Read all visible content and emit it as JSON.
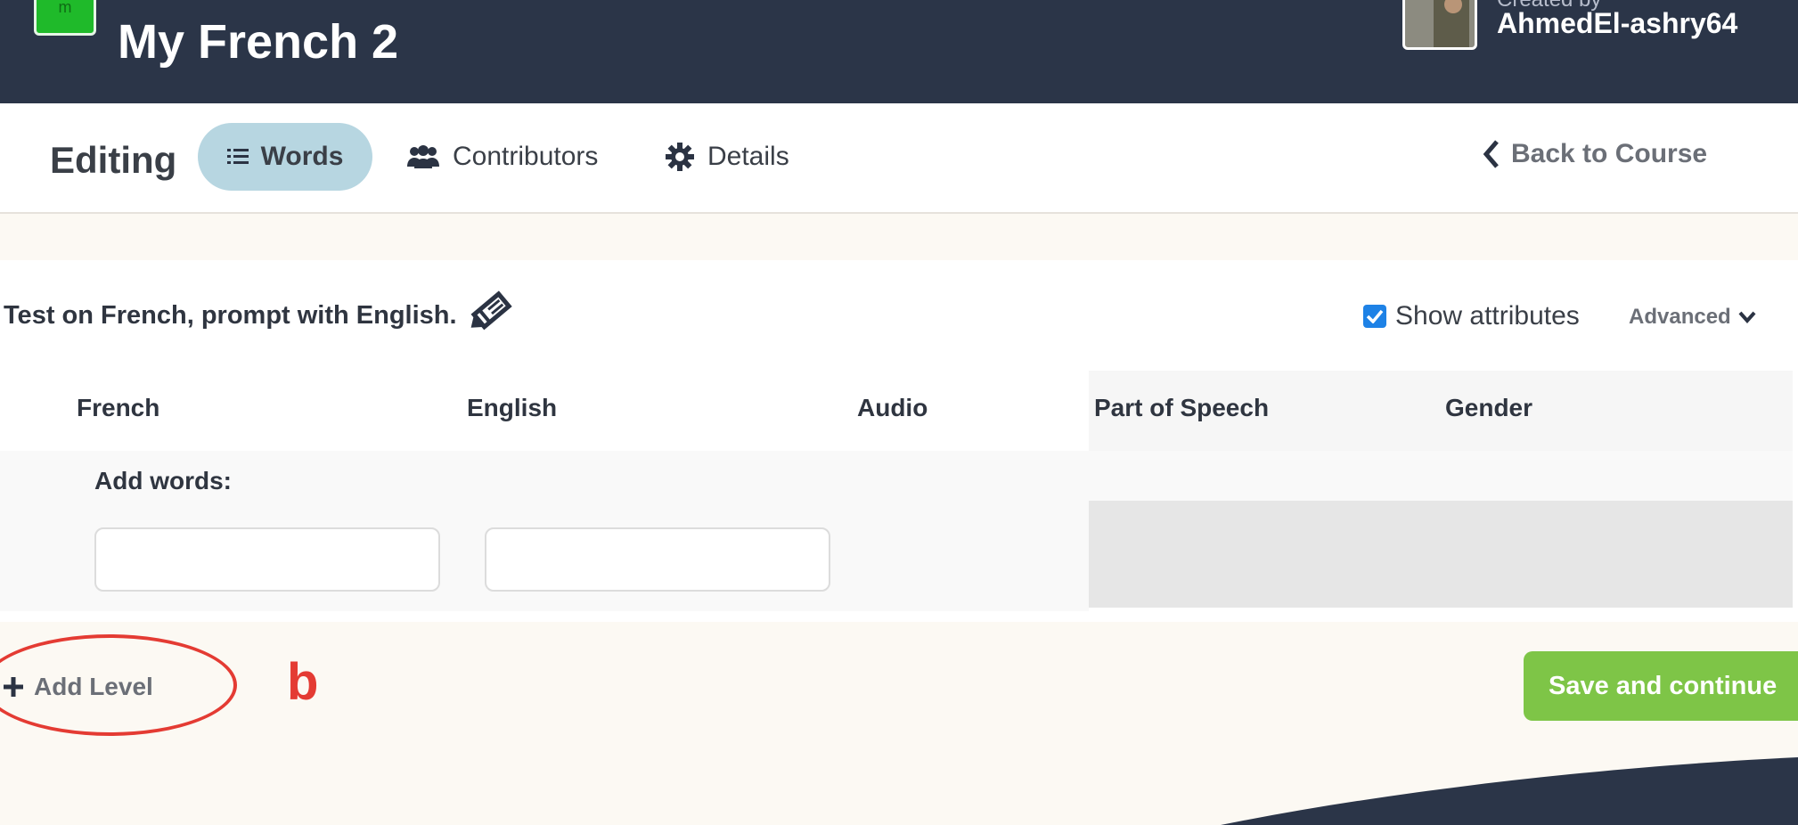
{
  "header": {
    "logo_text": "m",
    "course_title": "My French 2",
    "created_by_label": "Created by",
    "creator_name": "AhmedEl-ashry64"
  },
  "tabs": {
    "editing_label": "Editing",
    "words": "Words",
    "contributors": "Contributors",
    "details": "Details",
    "back": "Back to Course"
  },
  "panel": {
    "prompt_text": "Test on French, prompt with English.",
    "show_attributes_label": "Show attributes",
    "show_attributes_checked": true,
    "advanced_label": "Advanced",
    "columns": [
      "French",
      "English",
      "Audio",
      "Part of Speech",
      "Gender"
    ],
    "add_words_label": "Add words:",
    "french_input_value": "",
    "english_input_value": ""
  },
  "actions": {
    "add_level": "Add Level",
    "save_continue": "Save and continue"
  },
  "annotation": {
    "label": "b",
    "color": "#e43b33"
  },
  "colors": {
    "header_bg": "#2b3548",
    "active_tab_bg": "#b7d6e1",
    "save_button_bg": "#7ec547",
    "checkbox_blue": "#1e82e6",
    "page_bg": "#fcf9f3"
  }
}
